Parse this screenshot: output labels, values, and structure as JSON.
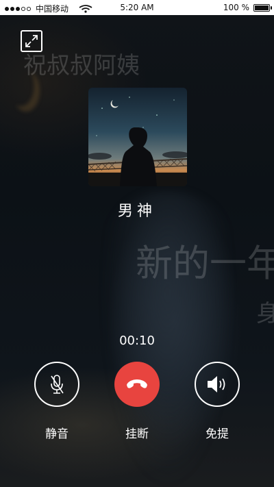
{
  "status_bar": {
    "carrier": "中国移动",
    "time": "5:20 AM",
    "battery_percent": "100 %",
    "battery_level": 1.0
  },
  "background_text": {
    "line1": "祝叔叔阿姨",
    "line2": "新的一年",
    "line3": "身"
  },
  "call": {
    "caller_name": "男神",
    "duration": "00:10"
  },
  "controls": {
    "mute_label": "静音",
    "hangup_label": "挂断",
    "speaker_label": "免提"
  },
  "colors": {
    "hangup": "#e8443f",
    "status_bar_bg": "#ffffff",
    "overlay_bg": "#0c0f13"
  },
  "icons": {
    "minimize": "minimize-icon",
    "mute": "mic-off-icon",
    "hangup": "phone-hangup-icon",
    "speaker": "speaker-icon"
  }
}
